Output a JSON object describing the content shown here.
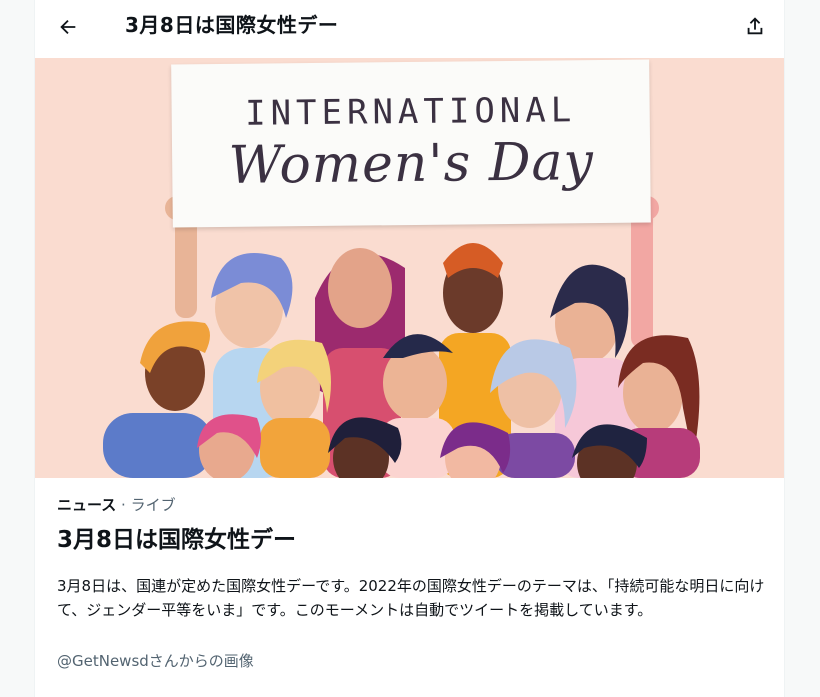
{
  "header": {
    "back_label": "←",
    "title": "3月8日は国際女性デー"
  },
  "hero": {
    "banner_line1": "INTERNATIONAL",
    "banner_line2": "Women's Day"
  },
  "event": {
    "category": "ニュース",
    "separator": " · ",
    "subcategory": "ライブ",
    "headline": "3月8日は国際女性デー",
    "description": "3月8日は、国連が定めた国際女性デーです。2022年の国際女性デーのテーマは、「持続可能な明日に向けて、ジェンダー平等をいま」です。このモーメントは自動でツイートを掲載しています。",
    "image_credit": "@GetNewsdさんからの画像"
  },
  "icons": {
    "back": "arrow-left-icon",
    "share": "share-upload-icon"
  },
  "colors": {
    "hero_bg": "#fadcd0",
    "text_primary": "#0f1419",
    "text_secondary": "#536471"
  }
}
